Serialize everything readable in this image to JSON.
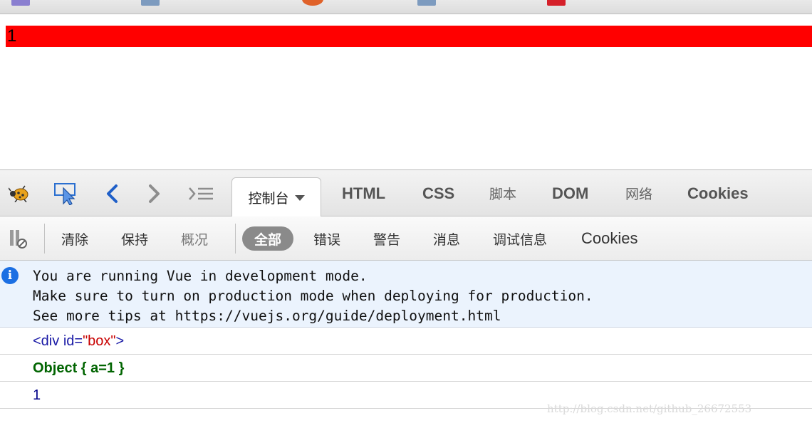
{
  "page": {
    "box_text": "1"
  },
  "devtools": {
    "tabs": [
      "控制台",
      "HTML",
      "CSS",
      "脚本",
      "DOM",
      "网络",
      "Cookies"
    ],
    "subtoolbar": {
      "clear": "清除",
      "persist": "保持",
      "profile": "概况",
      "all": "全部",
      "errors": "错误",
      "warnings": "警告",
      "info": "消息",
      "debug": "调试信息",
      "cookies": "Cookies"
    }
  },
  "console": {
    "info_lines": [
      "You are running Vue in development mode.",
      "Make sure to turn on production mode when deploying for production.",
      "See more tips at https://vuejs.org/guide/deployment.html"
    ],
    "element_log": {
      "open": "<div",
      "attr_name": "id=",
      "attr_value": "\"box\"",
      "close": ">"
    },
    "object_log": "Object { a=1 }",
    "number_log": "1"
  },
  "watermark": "http://blog.csdn.net/github_26672553",
  "colors": {
    "box_background": "#ff0000",
    "info_background": "#ebf3fd",
    "object_color": "#006400"
  },
  "icons": [
    "firebug-bug-icon",
    "inspect-cursor-icon",
    "back-icon",
    "forward-icon",
    "command-line-icon",
    "pause-icon",
    "info-icon"
  ]
}
